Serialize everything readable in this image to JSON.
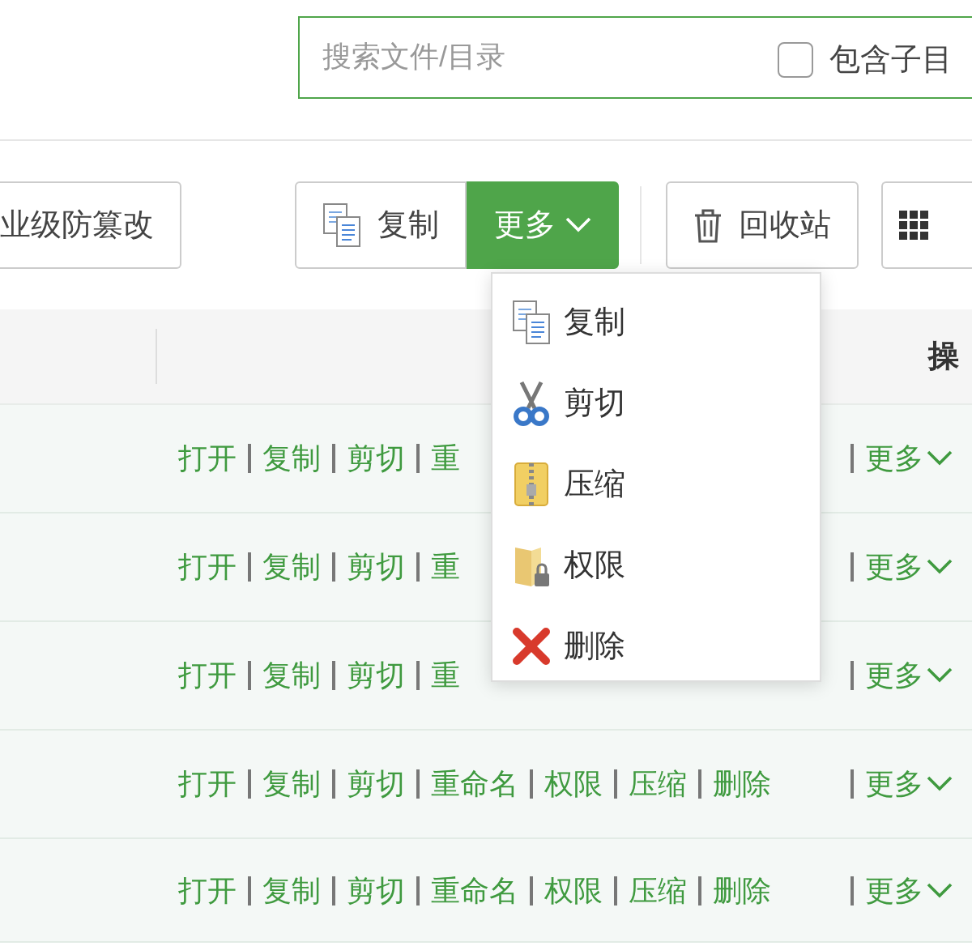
{
  "search": {
    "placeholder": "搜索文件/目录",
    "subdir_label": "包含子目",
    "subdir_checked": false
  },
  "toolbar": {
    "tamper_button": "业级防篡改",
    "copy_button": "复制",
    "more_button": "更多",
    "recycle_button": "回收站"
  },
  "table": {
    "columns": [
      "操"
    ],
    "rows": [
      {
        "actions": [
          "打开",
          "复制",
          "剪切",
          "重"
        ],
        "more": "更多"
      },
      {
        "actions": [
          "打开",
          "复制",
          "剪切",
          "重"
        ],
        "more": "更多"
      },
      {
        "actions": [
          "打开",
          "复制",
          "剪切",
          "重"
        ],
        "more": "更多"
      },
      {
        "actions": [
          "打开",
          "复制",
          "剪切",
          "重命名",
          "权限",
          "压缩",
          "删除"
        ],
        "more": "更多"
      },
      {
        "actions": [
          "打开",
          "复制",
          "剪切",
          "重命名",
          "权限",
          "压缩",
          "删除"
        ],
        "more": "更多"
      }
    ]
  },
  "more_menu": {
    "open": true,
    "items": [
      {
        "kind": "copy",
        "label": "复制"
      },
      {
        "kind": "cut",
        "label": "剪切"
      },
      {
        "kind": "zip",
        "label": "压缩"
      },
      {
        "kind": "permission",
        "label": "权限"
      },
      {
        "kind": "delete",
        "label": "删除"
      }
    ]
  }
}
